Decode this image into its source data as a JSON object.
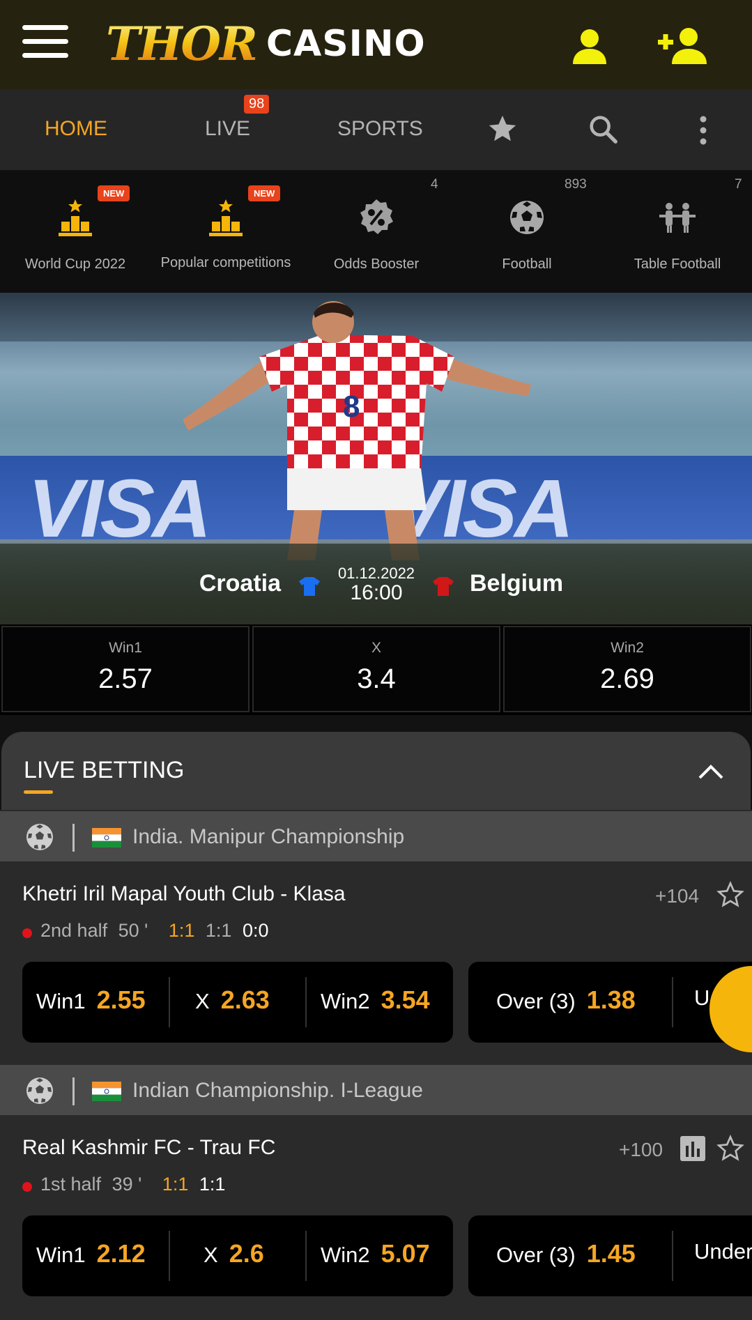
{
  "header": {
    "logo_thor": "THOR",
    "logo_casino": "CASINO"
  },
  "nav": {
    "home": "HOME",
    "live": "LIVE",
    "live_badge": "98",
    "sports": "SPORTS"
  },
  "categories": [
    {
      "label": "World Cup 2022",
      "badge": "NEW"
    },
    {
      "label": "Popular competitions",
      "badge": "NEW"
    },
    {
      "label": "Odds Booster",
      "count": "4"
    },
    {
      "label": "Football",
      "count": "893"
    },
    {
      "label": "Table Football",
      "count": "7"
    }
  ],
  "banner": {
    "team1": "Croatia",
    "team2": "Belgium",
    "date": "01.12.2022",
    "time": "16:00",
    "board_text": "VISA",
    "team1_color": "#1a6ff0",
    "team2_color": "#d01818"
  },
  "odds": [
    {
      "label": "Win1",
      "value": "2.57"
    },
    {
      "label": "X",
      "value": "3.4"
    },
    {
      "label": "Win2",
      "value": "2.69"
    }
  ],
  "live_betting": {
    "title": "LIVE BETTING",
    "leagues": [
      {
        "name": "India. Manipur Championship",
        "match": {
          "title": "Khetri Iril Mapal Youth Club - Klasa",
          "count": "+104",
          "period": "2nd half",
          "minute": "50 '",
          "score1": "1:1",
          "score2": "1:1",
          "score3": "0:0",
          "bets": [
            {
              "label": "Win1",
              "odd": "2.55"
            },
            {
              "label": "X",
              "odd": "2.63"
            },
            {
              "label": "Win2",
              "odd": "3.54"
            },
            {
              "label": "Over (3)",
              "odd": "1.38"
            },
            {
              "label": "U",
              "odd": ""
            }
          ]
        }
      },
      {
        "name": "Indian Championship. I-League",
        "match": {
          "title": "Real Kashmir FC - Trau FC",
          "count": "+100",
          "period": "1st half",
          "minute": "39 '",
          "score1": "1:1",
          "score2": "1:1",
          "bets": [
            {
              "label": "Win1",
              "odd": "2.12"
            },
            {
              "label": "X",
              "odd": "2.6"
            },
            {
              "label": "Win2",
              "odd": "5.07"
            },
            {
              "label": "Over (3)",
              "odd": "1.45"
            },
            {
              "label": "Under",
              "odd": ""
            }
          ]
        }
      }
    ]
  },
  "colors": {
    "accent": "#f5a623",
    "live_badge": "#e8431b",
    "live_dot": "#e0131b",
    "header_icons": "#f3f00b"
  }
}
